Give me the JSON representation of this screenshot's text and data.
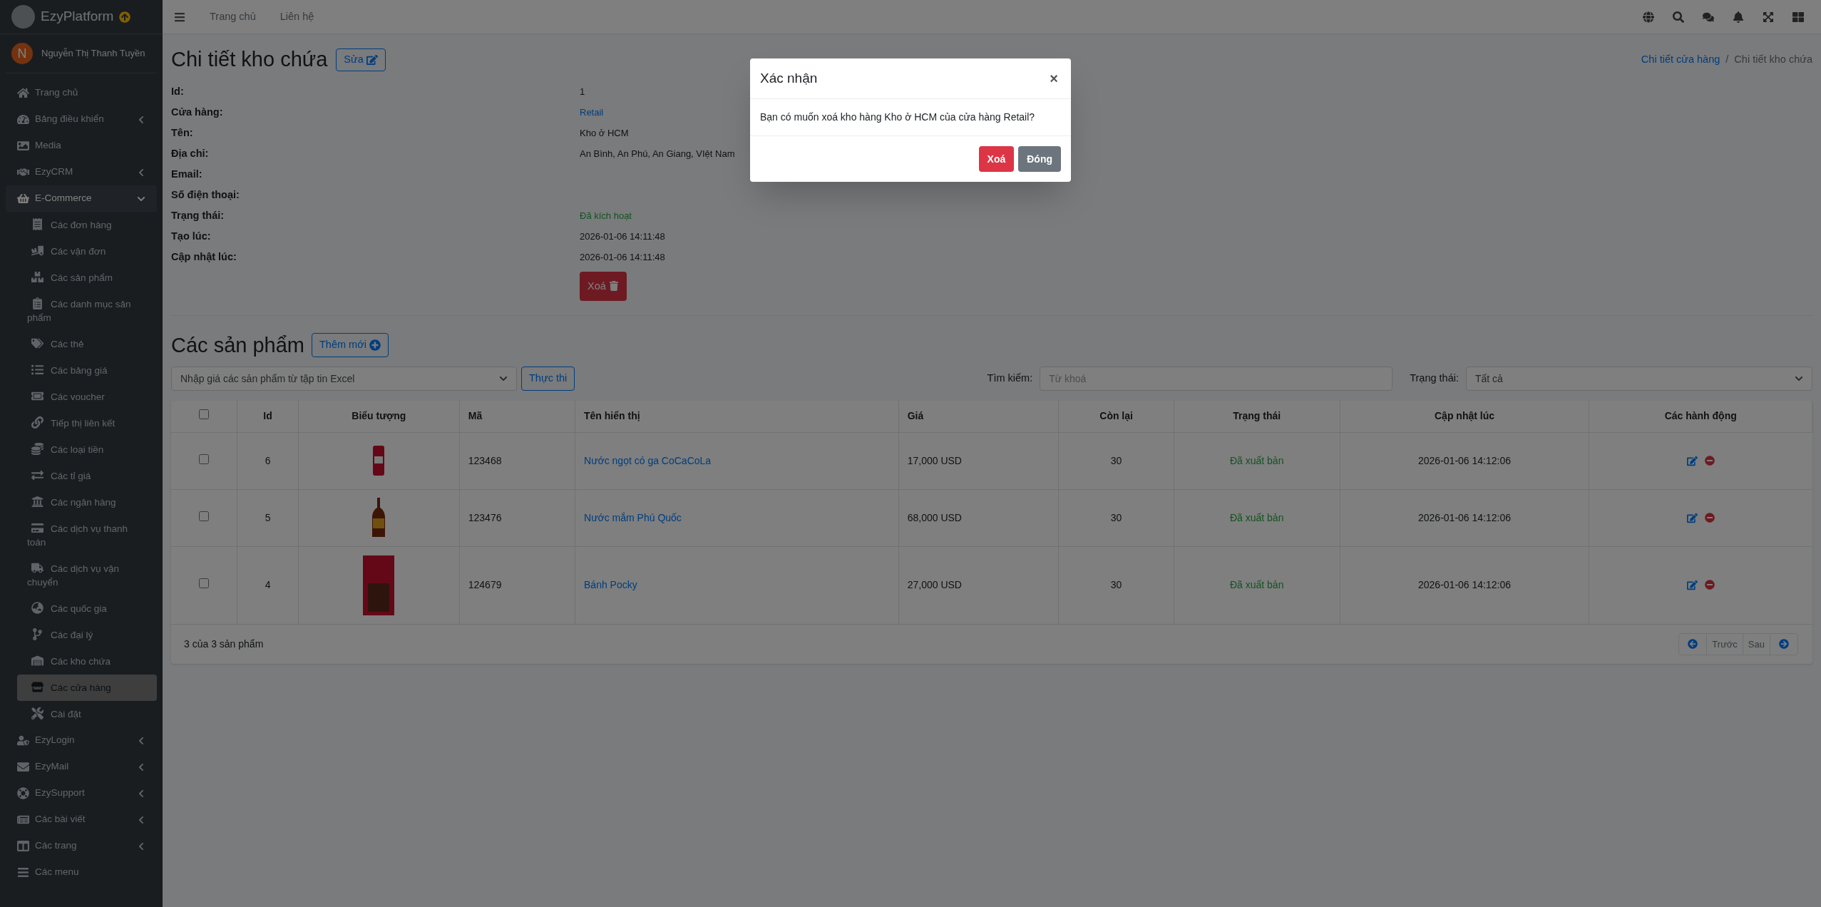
{
  "sidebar": {
    "brand": "EzyPlatform",
    "user": {
      "initial": "N",
      "name": "Nguyễn Thị Thanh Tuyền"
    },
    "items": [
      {
        "label": "Trang chủ"
      },
      {
        "label": "Bảng điều khiển",
        "expanded": false
      },
      {
        "label": "Media"
      },
      {
        "label": "EzyCRM",
        "expanded": false
      },
      {
        "label": "E-Commerce",
        "expanded": true,
        "children": [
          {
            "label": "Các đơn hàng",
            "selected": false
          },
          {
            "label": "Các vận đơn",
            "selected": false
          },
          {
            "label": "Các sản phẩm",
            "selected": false
          },
          {
            "label": "Các danh mục sản phẩm",
            "selected": false
          },
          {
            "label": "Các thẻ",
            "selected": false
          },
          {
            "label": "Các bảng giá",
            "selected": false
          },
          {
            "label": "Các voucher",
            "selected": false
          },
          {
            "label": "Tiếp thị liên kết",
            "selected": false
          },
          {
            "label": "Các loại tiền",
            "selected": false
          },
          {
            "label": "Các tỉ giá",
            "selected": false
          },
          {
            "label": "Các ngân hàng",
            "selected": false
          },
          {
            "label": "Các dịch vụ thanh toán",
            "selected": false
          },
          {
            "label": "Các dịch vụ vận chuyển",
            "selected": false
          },
          {
            "label": "Các quốc gia",
            "selected": false
          },
          {
            "label": "Các đại lý",
            "selected": false
          },
          {
            "label": "Các kho chứa",
            "selected": false
          },
          {
            "label": "Các cửa hàng",
            "selected": true
          },
          {
            "label": "Cài đặt",
            "selected": false
          }
        ]
      },
      {
        "label": "EzyLogin",
        "expanded": false
      },
      {
        "label": "EzyMail",
        "expanded": false
      },
      {
        "label": "EzySupport",
        "expanded": false
      },
      {
        "label": "Các bài viết",
        "expanded": false
      },
      {
        "label": "Các trang",
        "expanded": false
      },
      {
        "label": "Các menu"
      }
    ]
  },
  "topbar": {
    "links": [
      "Trang chủ",
      "Liên hệ"
    ]
  },
  "page": {
    "title": "Chi tiết kho chứa",
    "edit_button": "Sửa",
    "breadcrumb": [
      {
        "label": "Chi tiết cửa hàng",
        "link": true
      },
      {
        "label": "Chi tiết kho chứa",
        "link": false
      }
    ],
    "breadcrumb_separator": "/",
    "details": [
      {
        "label": "Id:",
        "value": "1",
        "kind": "text"
      },
      {
        "label": "Cửa hàng:",
        "value": "Retail",
        "kind": "link"
      },
      {
        "label": "Tên:",
        "value": "Kho ở HCM",
        "kind": "text"
      },
      {
        "label": "Địa chỉ:",
        "value": "An Bình, An Phú, An Giang, VIệt Nam",
        "kind": "text"
      },
      {
        "label": "Email:"
      },
      {
        "label": "Số điện thoại:"
      },
      {
        "label": "Trạng thái:",
        "value": "Đã kích hoạt",
        "kind": "status"
      },
      {
        "label": "Tạo lúc:",
        "value": "2026-01-06 14:11:48",
        "kind": "text"
      },
      {
        "label": "Cập nhật lúc:",
        "value": "2026-01-06 14:11:48",
        "kind": "text"
      }
    ],
    "delete_button": "Xoá"
  },
  "products": {
    "title": "Các sản phẩm",
    "add_button": "Thêm mới",
    "import_select": {
      "value": "Nhập giá các sản phẩm từ tập tin Excel"
    },
    "run_button": "Thực thi",
    "search": {
      "label": "Tìm kiếm:",
      "placeholder": "Từ khoá"
    },
    "status_filter": {
      "label": "Trạng thái:",
      "value": "Tất cả"
    },
    "table": {
      "header_checked": false,
      "columns": [
        "Id",
        "Biểu tượng",
        "Mã",
        "Tên hiển thị",
        "Giá",
        "Còn lại",
        "Trạng thái",
        "Cập nhật lúc",
        "Các hành động"
      ],
      "rows": [
        {
          "checked": false,
          "id": "6",
          "kind": "can",
          "code": "123468",
          "name": "Nước ngọt có ga CoCaCoLa",
          "price": "17,000 USD",
          "remaining": "30",
          "status": "Đã xuất bản",
          "updated": "2026-01-06 14:12:06"
        },
        {
          "checked": false,
          "id": "5",
          "kind": "bottle",
          "code": "123476",
          "name": "Nước mắm Phú Quốc",
          "price": "68,000 USD",
          "remaining": "30",
          "status": "Đã xuất bản",
          "updated": "2026-01-06 14:12:06"
        },
        {
          "checked": false,
          "id": "4",
          "kind": "box",
          "code": "124679",
          "name": "Bánh Pocky",
          "price": "27,000 USD",
          "remaining": "30",
          "status": "Đã xuất bản",
          "updated": "2026-01-06 14:12:06"
        }
      ]
    },
    "summary": "3 của 3 sản phẩm",
    "pagination": [
      "Trước",
      "Sau"
    ]
  },
  "modal": {
    "title": "Xác nhận",
    "close": "×",
    "message": "Bạn có muốn xoá kho hàng Kho ở HCM của cửa hàng Retail?",
    "buttons": [
      {
        "label": "Xoá",
        "kind": "danger"
      },
      {
        "label": "Đóng",
        "kind": "secondary"
      }
    ]
  }
}
